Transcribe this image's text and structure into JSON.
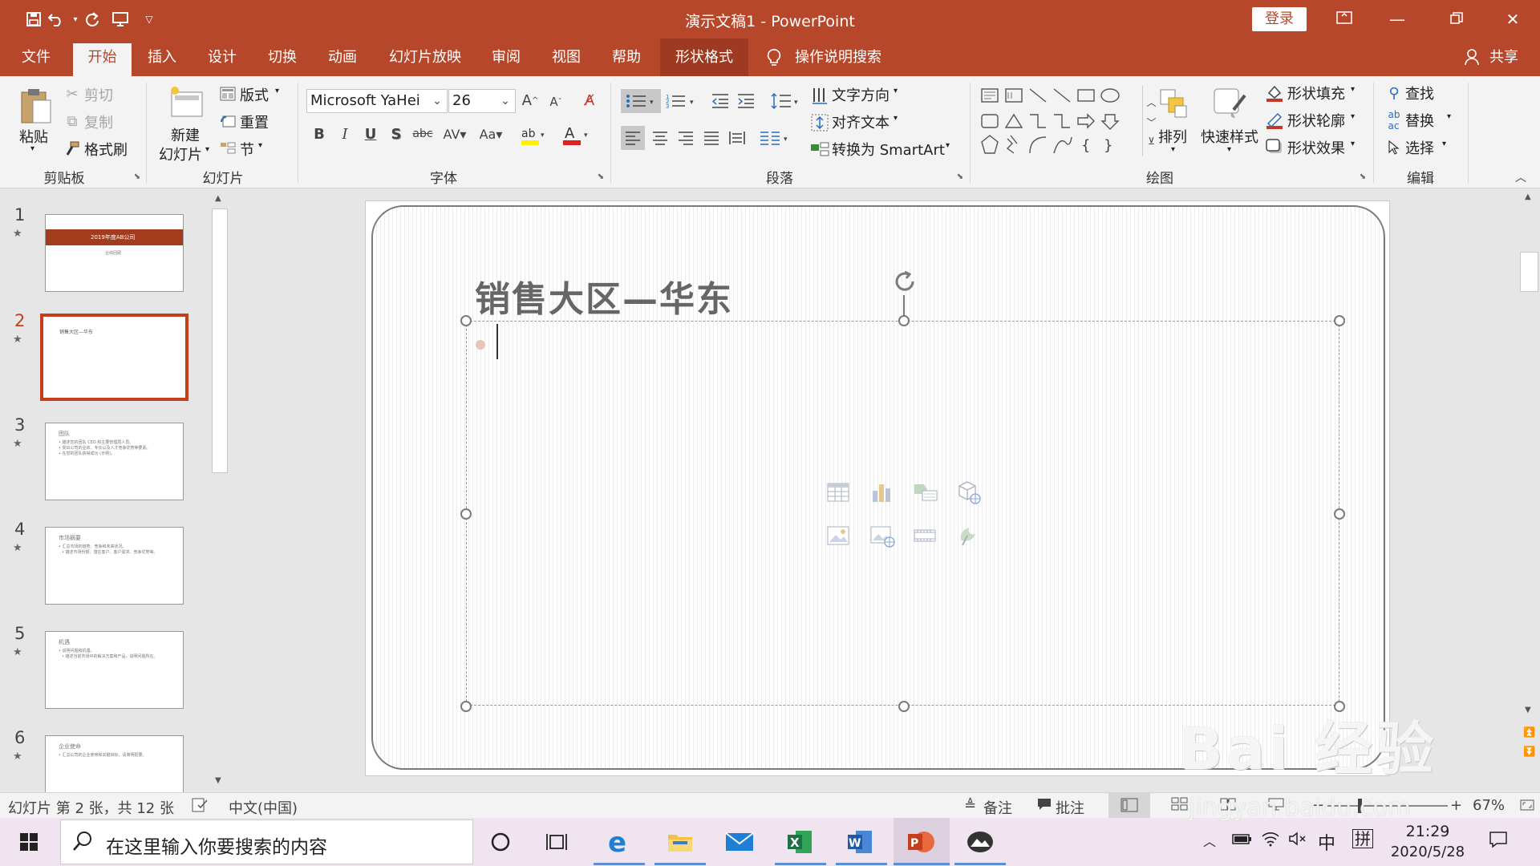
{
  "window": {
    "title": "演示文稿1  -  PowerPoint",
    "login_label": "登录"
  },
  "tabs": [
    {
      "label": "文件"
    },
    {
      "label": "开始"
    },
    {
      "label": "插入"
    },
    {
      "label": "设计"
    },
    {
      "label": "切换"
    },
    {
      "label": "动画"
    },
    {
      "label": "幻灯片放映"
    },
    {
      "label": "审阅"
    },
    {
      "label": "视图"
    },
    {
      "label": "帮助"
    },
    {
      "label": "形状格式"
    }
  ],
  "tell_me": "操作说明搜索",
  "share": "共享",
  "ribbon": {
    "clipboard": {
      "paste": "粘贴",
      "cut": "剪切",
      "copy": "复制",
      "format_painter": "格式刷",
      "label": "剪贴板"
    },
    "slides": {
      "new_slide_1": "新建",
      "new_slide_2": "幻灯片",
      "layout": "版式",
      "reset": "重置",
      "section": "节",
      "label": "幻灯片"
    },
    "font": {
      "name": "Microsoft YaHei",
      "size": "26",
      "label": "字体"
    },
    "paragraph": {
      "text_direction": "文字方向",
      "align_text": "对齐文本",
      "convert_smartart": "转换为 SmartArt",
      "label": "段落"
    },
    "drawing": {
      "arrange": "排列",
      "quick_styles": "快速样式",
      "shape_fill": "形状填充",
      "shape_outline": "形状轮廓",
      "shape_effects": "形状效果",
      "label": "绘图"
    },
    "editing": {
      "find": "查找",
      "replace": "替换",
      "select": "选择",
      "label": "编辑"
    }
  },
  "slides": [
    {
      "num": "1",
      "title": "2019年度AB公司",
      "subtitle": "业绩回顾"
    },
    {
      "num": "2",
      "title": "销售大区—华东"
    },
    {
      "num": "3",
      "title": "团队",
      "lines": [
        "• 描述您的团队 CEO 和主要管理层人员。",
        "• 突出公司的业绩、专长以及人才竞争优势等要素。",
        "• 在您的团队获得成功 (示例)。"
      ]
    },
    {
      "num": "4",
      "title": "市场摘要",
      "lines": [
        "• 汇总市场的趋势、竞争和未来状况。",
        "• 描述市场份额、潜在客户、客户需求、竞争优势等。"
      ]
    },
    {
      "num": "5",
      "title": "机遇",
      "lines": [
        "• 说明问题和机遇。",
        "• 描述当前市场中的解决方案和产品，说明问题所在。"
      ]
    },
    {
      "num": "6",
      "title": "企业使命",
      "lines": [
        "• 汇总公司的企业使命和关键目标，请简明扼要。"
      ]
    }
  ],
  "slide_main": {
    "title": "销售大区—华东"
  },
  "status": {
    "slide_info": "幻灯片 第 2 张，共 12 张",
    "language": "中文(中国)",
    "notes": "备注",
    "comments": "批注",
    "zoom": "67%"
  },
  "taskbar": {
    "search_placeholder": "在这里输入你要搜索的内容",
    "ime": "中",
    "ime2": "拼",
    "time": "21:29",
    "date": "2020/5/28"
  },
  "watermark": {
    "text": "Bai 经验",
    "url": "jingyan.baidu.com"
  },
  "colors": {
    "accent": "#b7472a",
    "selection": "#c43e1c"
  }
}
